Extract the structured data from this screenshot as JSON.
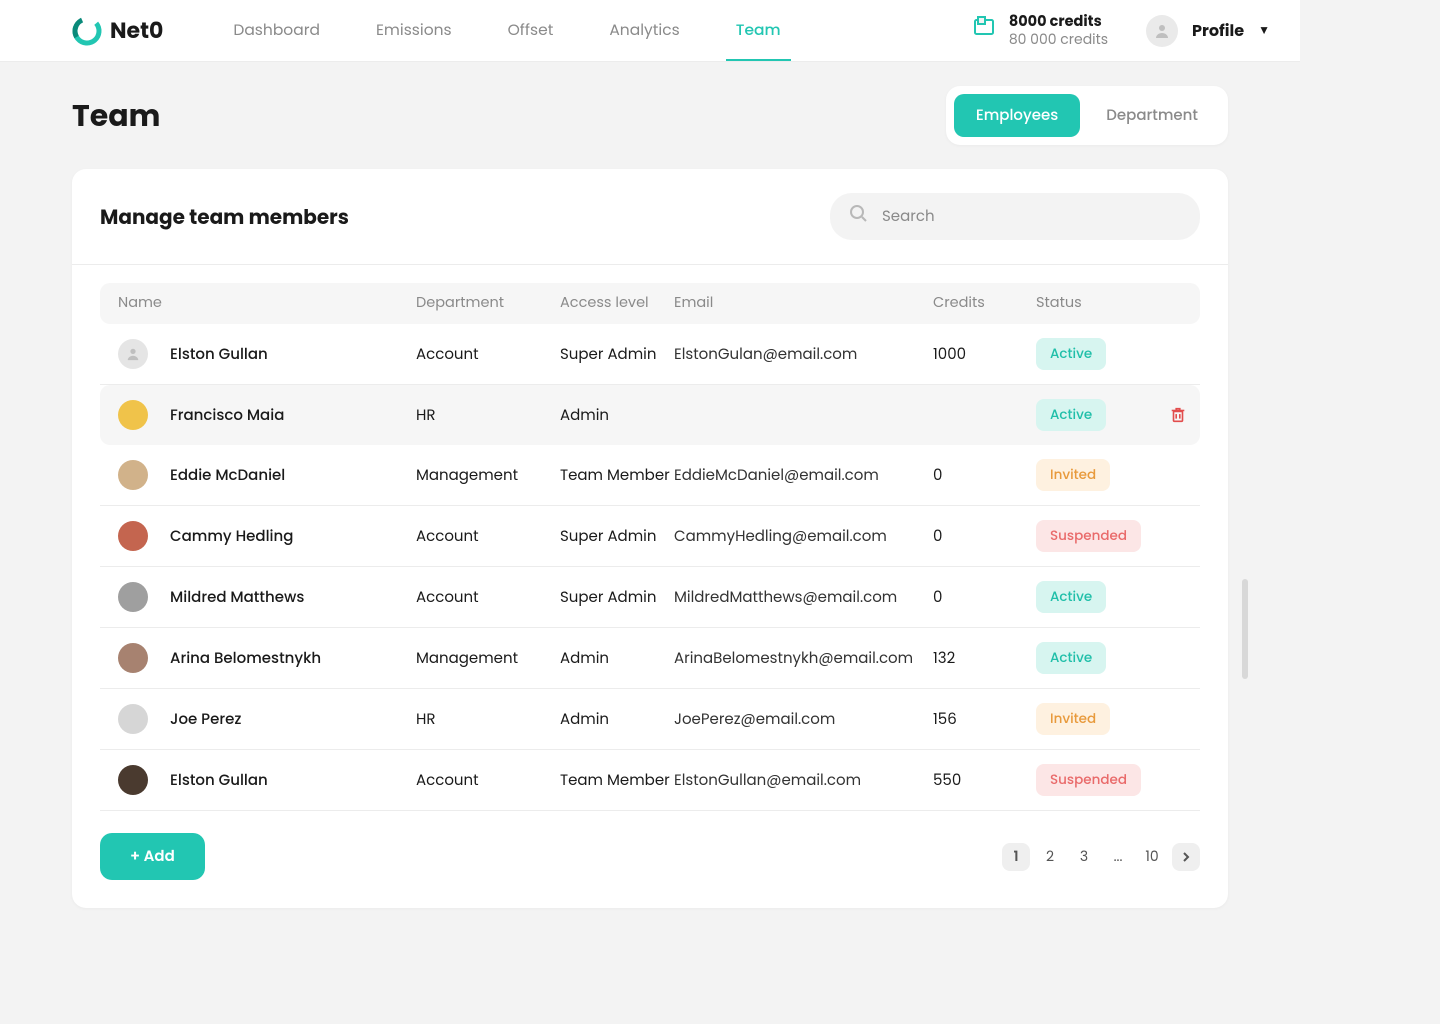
{
  "brand": "Net0",
  "nav": {
    "items": [
      "Dashboard",
      "Emissions",
      "Offset",
      "Analytics",
      "Team"
    ],
    "active": 4
  },
  "credits": {
    "main": "8000 credits",
    "sub": "80 000 credits"
  },
  "profile_label": "Profile",
  "page_title": "Team",
  "tabs": {
    "employees": "Employees",
    "department": "Department"
  },
  "card": {
    "title": "Manage team members",
    "search_placeholder": "Search"
  },
  "columns": {
    "name": "Name",
    "department": "Department",
    "access": "Access level",
    "email": "Email",
    "credits": "Credits",
    "status": "Status"
  },
  "rows": [
    {
      "name": "Elston Gullan",
      "department": "Account",
      "access": "Super Admin",
      "email": "ElstonGulan@email.com",
      "credits": "1000",
      "status": "Active",
      "placeholder_avatar": true
    },
    {
      "name": "Francisco Maia",
      "department": "HR",
      "access": "Admin",
      "email": "",
      "credits": "",
      "status": "Active",
      "highlight": true,
      "show_delete": true,
      "avatar_bg": "#f0c34a"
    },
    {
      "name": "Eddie McDaniel",
      "department": "Management",
      "access": "Team Member",
      "email": "EddieMcDaniel@email.com",
      "credits": "0",
      "status": "Invited",
      "avatar_bg": "#d1b28a"
    },
    {
      "name": "Cammy Hedling",
      "department": "Account",
      "access": "Super Admin",
      "email": "CammyHedling@email.com",
      "credits": "0",
      "status": "Suspended",
      "avatar_bg": "#c4654f"
    },
    {
      "name": "Mildred Matthews",
      "department": "Account",
      "access": "Super Admin",
      "email": "MildredMatthews@email.com",
      "credits": "0",
      "status": "Active",
      "avatar_bg": "#9f9f9f"
    },
    {
      "name": "Arina Belomestnykh",
      "department": "Management",
      "access": "Admin",
      "email": "ArinaBelomestnykh@email.com",
      "credits": "132",
      "status": "Active",
      "avatar_bg": "#a78270"
    },
    {
      "name": "Joe Perez",
      "department": "HR",
      "access": "Admin",
      "email": "JoePerez@email.com",
      "credits": "156",
      "status": "Invited",
      "avatar_bg": "#d6d6d6"
    },
    {
      "name": "Elston Gullan",
      "department": "Account",
      "access": "Team Member",
      "email": "ElstonGullan@email.com",
      "credits": "550",
      "status": "Suspended",
      "avatar_bg": "#4a3a2f"
    }
  ],
  "add_label": "+ Add",
  "pages": [
    "1",
    "2",
    "3",
    "...",
    "10"
  ]
}
